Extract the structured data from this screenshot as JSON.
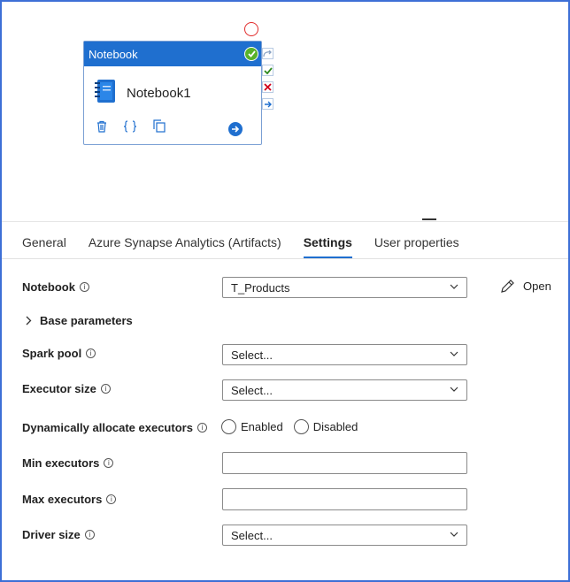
{
  "canvas": {
    "activity": {
      "header": "Notebook",
      "name": "Notebook1",
      "tools": {
        "delete_icon": "trash-icon",
        "code_icon": "braces-icon",
        "copy_icon": "copy-icon",
        "go_icon": "arrow-right-circle-icon"
      }
    },
    "side_icons": [
      "skip-icon",
      "success-icon",
      "failure-icon",
      "completion-icon"
    ],
    "colors": {
      "accent": "#1f6fcf",
      "success": "#58b22a",
      "error": "#e12b2b"
    }
  },
  "tabs": [
    {
      "label": "General"
    },
    {
      "label": "Azure Synapse Analytics (Artifacts)"
    },
    {
      "label": "Settings",
      "active": true
    },
    {
      "label": "User properties"
    }
  ],
  "form": {
    "notebook": {
      "label": "Notebook",
      "value": "T_Products",
      "open_label": "Open"
    },
    "base_parameters": {
      "label": "Base parameters"
    },
    "spark_pool": {
      "label": "Spark pool",
      "value": "Select..."
    },
    "executor_size": {
      "label": "Executor size",
      "value": "Select..."
    },
    "dynamic": {
      "label": "Dynamically allocate executors",
      "enabled": "Enabled",
      "disabled": "Disabled"
    },
    "min_executors": {
      "label": "Min executors",
      "value": ""
    },
    "max_executors": {
      "label": "Max executors",
      "value": ""
    },
    "driver_size": {
      "label": "Driver size",
      "value": "Select..."
    }
  }
}
